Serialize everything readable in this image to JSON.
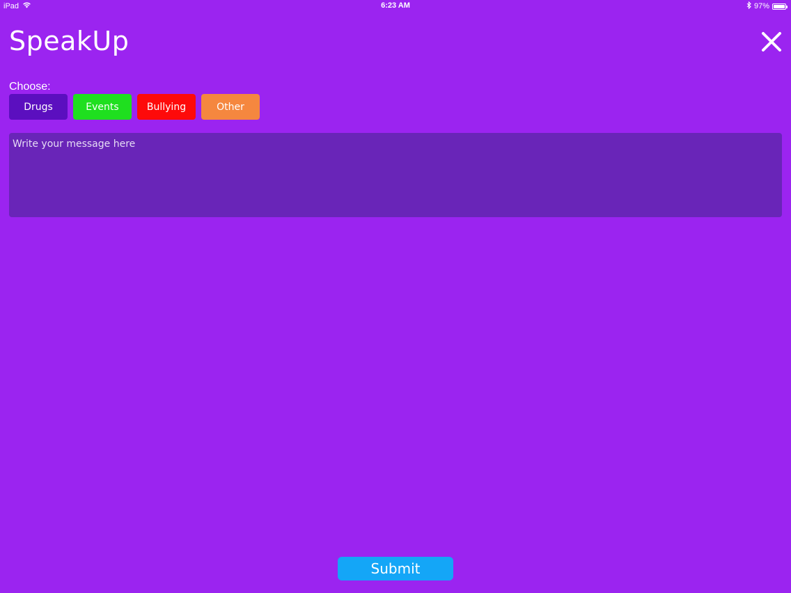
{
  "status_bar": {
    "device": "iPad",
    "time": "6:23 AM",
    "battery_percent": "97%",
    "battery_level": 0.97,
    "icons": [
      "wifi-icon",
      "bluetooth-icon",
      "battery-icon"
    ]
  },
  "header": {
    "title": "SpeakUp",
    "close_icon": "close-icon"
  },
  "categories": {
    "label": "Choose:",
    "items": [
      {
        "label": "Drugs",
        "color": "#5b0fbf"
      },
      {
        "label": "Events",
        "color": "#1fdf1f"
      },
      {
        "label": "Bullying",
        "color": "#fe0a0a"
      },
      {
        "label": "Other",
        "color": "#f5873f"
      }
    ]
  },
  "message": {
    "value": "",
    "placeholder": "Write your message here",
    "background_color": "#6925b8"
  },
  "submit": {
    "label": "Submit",
    "color": "#14a6f7"
  },
  "colors": {
    "background": "#9b24f0",
    "text": "#ffffff"
  }
}
